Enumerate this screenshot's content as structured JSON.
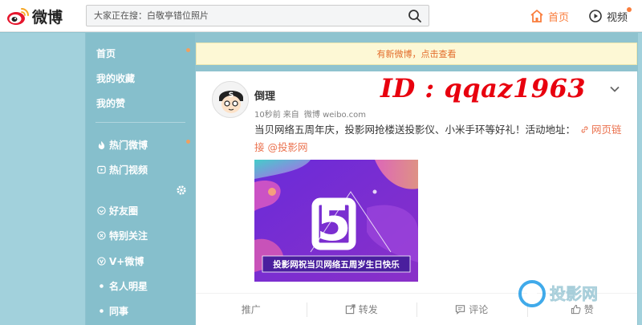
{
  "header": {
    "logo_text": "微博",
    "search_placeholder": "大家正在搜：白敬亭错位照片",
    "nav_home": "首页",
    "nav_video": "视频"
  },
  "sidebar": {
    "top_items": [
      "首页",
      "我的收藏",
      "我的赞"
    ],
    "hot_items": [
      "热门微博",
      "热门视频"
    ],
    "group_items": [
      "好友圈",
      "特别关注",
      "V+微博"
    ],
    "sub_items": [
      "名人明星",
      "同事"
    ]
  },
  "notice": "有新微博，点击查看",
  "post": {
    "username": "倒理",
    "time": "10秒前",
    "source_prefix": "来自",
    "source": "微博 weibo.com",
    "text": "当贝网络五周年庆，投影网抢楼送投影仪、小米手环等好礼！活动地址：",
    "link_text": "网页链接",
    "mention": "@投影网",
    "image_caption": "投影网祝当贝网络五周岁生日快乐",
    "image_digit": "5"
  },
  "actions": {
    "promote": "推广",
    "repost": "转发",
    "comment": "评论",
    "like": "赞"
  },
  "overlay": {
    "id_text": "ID : qqaz1963",
    "corner_logo_text": "投影网"
  },
  "colors": {
    "accent": "#fa7d3c",
    "link": "#eb7350",
    "sidebar": "#86bfcc",
    "background": "#8fc3cf",
    "id_red": "#e8000e"
  }
}
